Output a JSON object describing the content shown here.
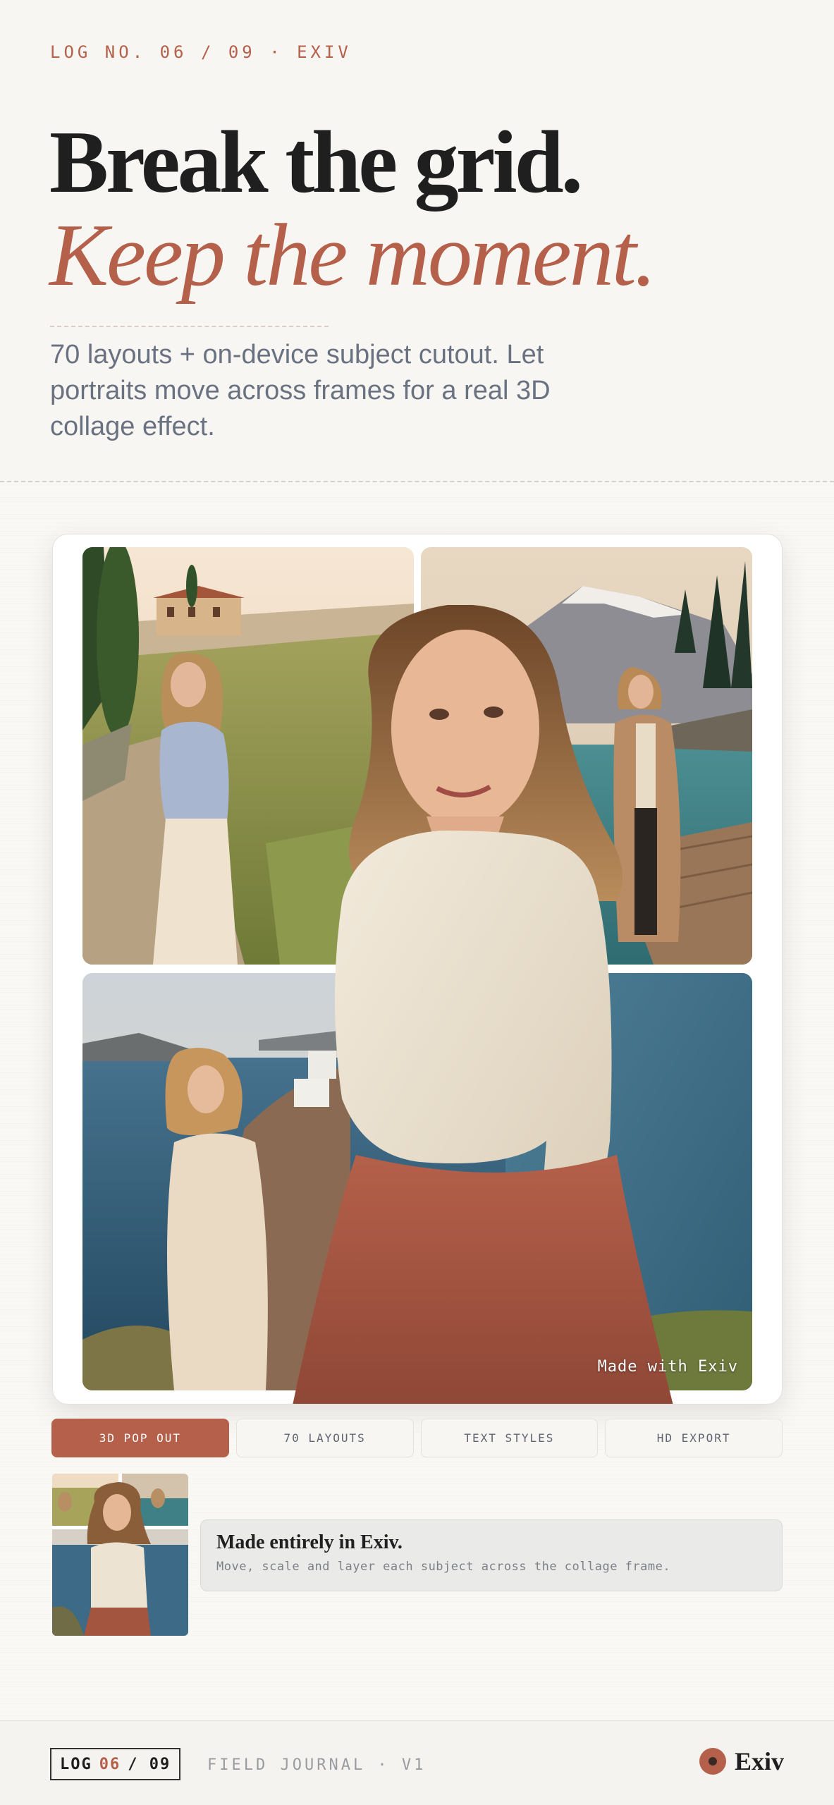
{
  "header": {
    "kicker": "LOG NO. 06 / 09 · EXIV",
    "headline_line1": "Break the grid.",
    "headline_line2": "Keep the moment.",
    "lede": "70 layouts + on-device subject cutout. Let portraits move across frames for a real 3D collage effect."
  },
  "collage": {
    "watermark": "Made with Exiv",
    "tiles": [
      {
        "scene": "tuscan-hillside-villa"
      },
      {
        "scene": "alpine-lake-dock"
      },
      {
        "scene": "coastal-cliff-sea"
      }
    ]
  },
  "tabs": [
    {
      "label": "3D POP OUT",
      "active": true
    },
    {
      "label": "70 LAYOUTS",
      "active": false
    },
    {
      "label": "TEXT STYLES",
      "active": false
    },
    {
      "label": "HD EXPORT",
      "active": false
    }
  ],
  "note": {
    "title": "Made entirely in Exiv.",
    "subtitle": "Move, scale and layer each subject across the collage frame."
  },
  "footer": {
    "log_label": "LOG",
    "log_number": "06",
    "log_total": "/ 09",
    "journal": "FIELD JOURNAL · V1",
    "brand": "Exiv"
  },
  "colors": {
    "accent": "#b5604a",
    "background": "#f7f6f3",
    "text": "#1e1e1e",
    "muted": "#6a7281"
  }
}
